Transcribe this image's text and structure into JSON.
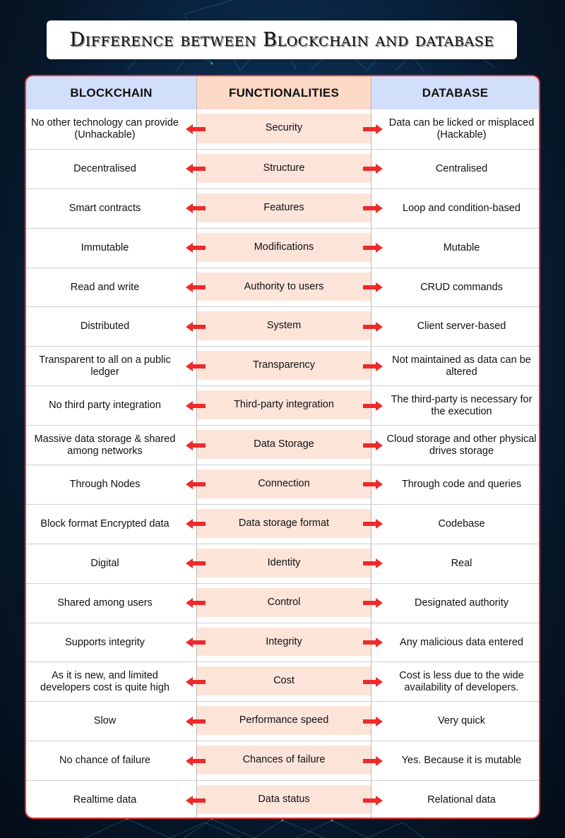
{
  "title": "Difference between Blockchain and database",
  "colors": {
    "table_border": "#e8343a",
    "header_side_bg": "#d1dffb",
    "header_mid_bg": "#fdd9c7",
    "mid_cell_bg": "#fde4d9",
    "arrow": "#ee2a2a"
  },
  "table": {
    "headers": {
      "left": "BLOCKCHAIN",
      "middle": "FUNCTIONALITIES",
      "right": "DATABASE"
    },
    "rows": [
      {
        "blockchain": "No other technology can provide (Unhackable)",
        "functionality": "Security",
        "database": "Data can be licked or misplaced (Hackable)"
      },
      {
        "blockchain": "Decentralised",
        "functionality": "Structure",
        "database": "Centralised"
      },
      {
        "blockchain": "Smart contracts",
        "functionality": "Features",
        "database": "Loop and condition-based"
      },
      {
        "blockchain": "Immutable",
        "functionality": "Modifications",
        "database": "Mutable"
      },
      {
        "blockchain": "Read and write",
        "functionality": "Authority to users",
        "database": "CRUD commands"
      },
      {
        "blockchain": "Distributed",
        "functionality": "System",
        "database": "Client server-based"
      },
      {
        "blockchain": "Transparent to all on a public ledger",
        "functionality": "Transparency",
        "database": "Not maintained as data can be altered"
      },
      {
        "blockchain": "No third party integration",
        "functionality": "Third-party integration",
        "database": "The third-party is necessary for the execution"
      },
      {
        "blockchain": "Massive data storage & shared among networks",
        "functionality": "Data Storage",
        "database": "Cloud storage and other physical drives storage"
      },
      {
        "blockchain": "Through Nodes",
        "functionality": "Connection",
        "database": "Through code and queries"
      },
      {
        "blockchain": "Block format Encrypted data",
        "functionality": "Data storage format",
        "database": "Codebase"
      },
      {
        "blockchain": "Digital",
        "functionality": "Identity",
        "database": "Real"
      },
      {
        "blockchain": "Shared among users",
        "functionality": "Control",
        "database": "Designated authority"
      },
      {
        "blockchain": "Supports integrity",
        "functionality": "Integrity",
        "database": "Any malicious data entered"
      },
      {
        "blockchain": "As it is new, and limited developers cost is quite high",
        "functionality": "Cost",
        "database": "Cost is less due to the wide availability of developers."
      },
      {
        "blockchain": "Slow",
        "functionality": "Performance speed",
        "database": "Very quick"
      },
      {
        "blockchain": "No chance of failure",
        "functionality": "Chances of failure",
        "database": "Yes. Because it is mutable"
      },
      {
        "blockchain": "Realtime data",
        "functionality": "Data status",
        "database": "Relational data"
      }
    ]
  }
}
